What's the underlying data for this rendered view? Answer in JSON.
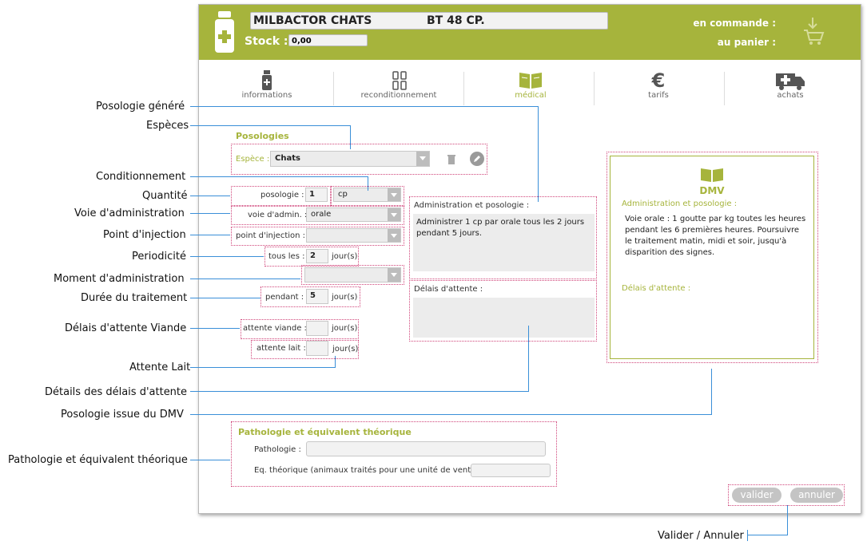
{
  "header": {
    "product_name": "MILBACTOR CHATS",
    "packaging": "BT 48 CP.",
    "stock_label": "Stock :",
    "stock_value": "0,00",
    "on_order_label": "en commande :",
    "in_cart_label": "au panier :"
  },
  "tabs": [
    {
      "label": "informations"
    },
    {
      "label": "reconditionnement"
    },
    {
      "label": "médical"
    },
    {
      "label": "tarifs"
    },
    {
      "label": "achats"
    }
  ],
  "posologies": {
    "title": "Posologies",
    "espece_label": "Espèce :",
    "espece_value": "Chats",
    "posologie_label": "posologie :",
    "posologie_value": "1",
    "unit_value": "cp",
    "voie_label": "voie d'admin. :",
    "voie_value": "orale",
    "point_label": "point d'injection :",
    "tous_les_label": "tous les :",
    "tous_les_value": "2",
    "jours_label": "jour(s)",
    "pendant_label": "pendant :",
    "pendant_value": "5",
    "viande_label": "attente viande :",
    "lait_label": "attente lait :"
  },
  "admin": {
    "label": "Administration et posologie :",
    "text": "Administrer 1 cp par orale tous les 2 jours pendant 5 jours.",
    "delais_label": "Délais d'attente :"
  },
  "dmv": {
    "title": "DMV",
    "admin_label": "Administration et posologie :",
    "text": "Voie orale : 1 goutte par kg toutes les heures pendant les 6 premières heures. Poursuivre le traitement matin, midi et soir, jusqu'à disparition des signes.",
    "delais_label": "Délais d'attente :"
  },
  "pathologie": {
    "title": "Pathologie et équivalent théorique",
    "pathologie_label": "Pathologie :",
    "eq_label": "Eq. théorique (animaux traités pour une unité de vente) :"
  },
  "buttons": {
    "valider": "valider",
    "annuler": "annuler"
  },
  "annotations": {
    "posologie_generee": "Posologie généré",
    "especes": "Espèces",
    "conditionnement": "Conditionnement",
    "quantite": "Quantité",
    "voie": "Voie d'administration",
    "point": "Point d'injection",
    "periodicite": "Periodicité",
    "moment": "Moment d'administration",
    "duree": "Durée du traitement",
    "delais_viande": "Délais d'attente Viande",
    "attente_lait": "Attente Lait",
    "details_delais": "Détails des délais d'attente",
    "posologie_dmv": "Posologie issue du DMV",
    "pathologie": "Pathologie et équivalent théorique",
    "valider_annuler": "Valider / Annuler"
  },
  "colors": {
    "accent": "#a6b43c",
    "annotation_line": "#3a8fd8",
    "dotted_border": "#d0457a"
  }
}
